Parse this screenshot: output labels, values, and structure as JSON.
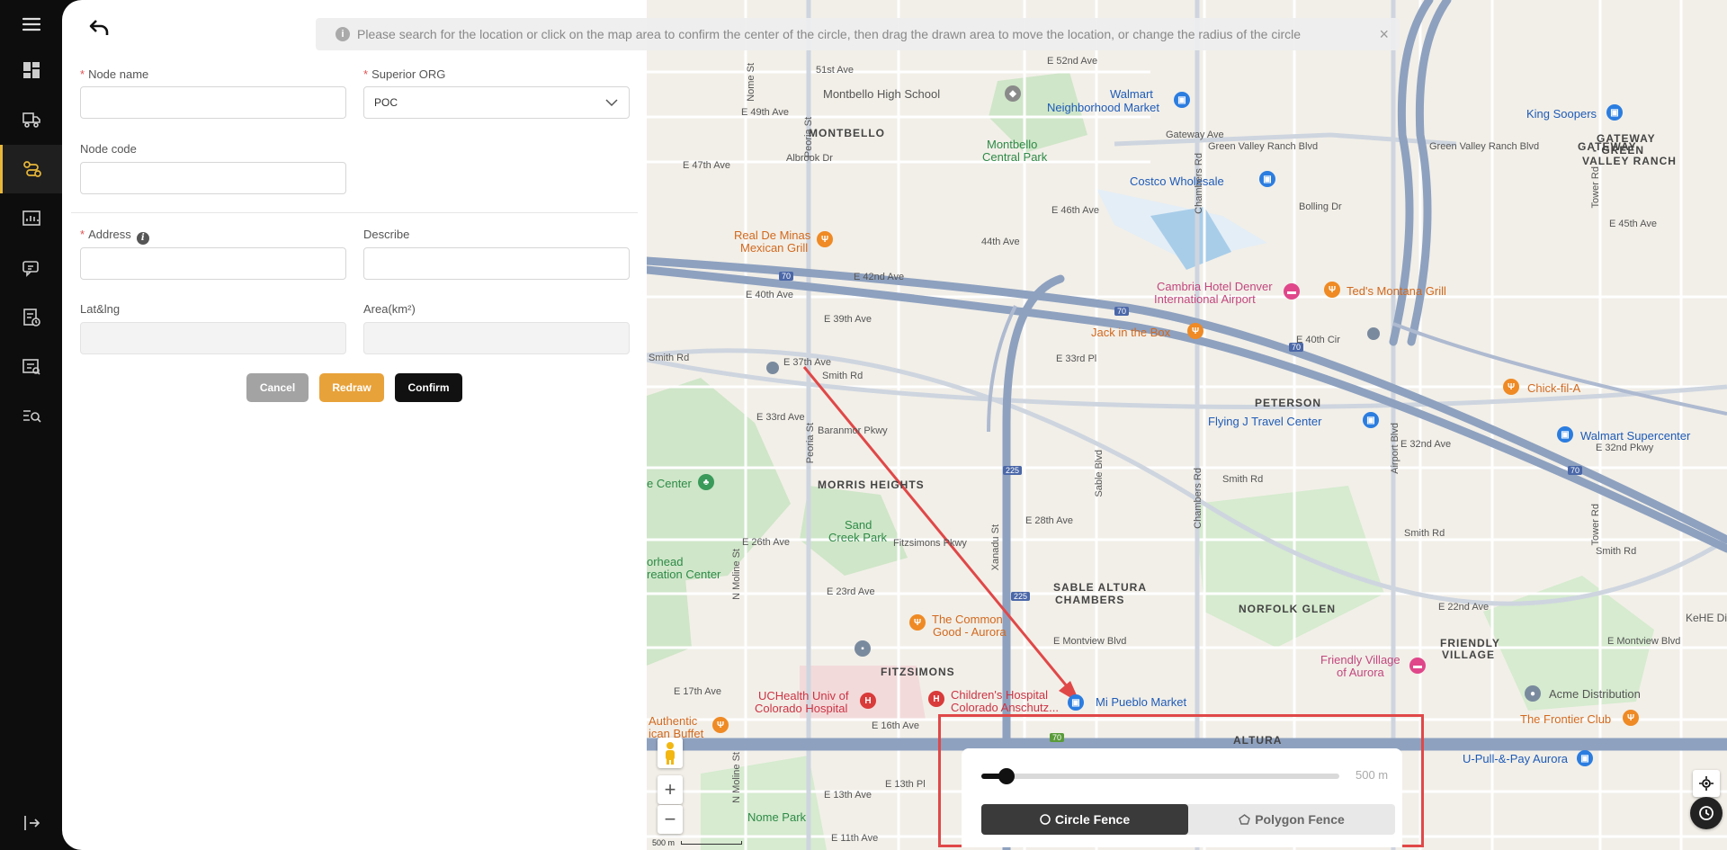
{
  "form": {
    "node_name": {
      "label": "Node name",
      "value": "",
      "required": true
    },
    "superior_org": {
      "label": "Superior ORG",
      "value": "POC",
      "required": true
    },
    "node_code": {
      "label": "Node code",
      "value": ""
    },
    "address": {
      "label": "Address",
      "value": "",
      "required": true
    },
    "describe": {
      "label": "Describe",
      "value": ""
    },
    "latlng": {
      "label": "Lat&lng",
      "value": ""
    },
    "area": {
      "label": "Area(km²)",
      "value": ""
    },
    "required_mark": "*",
    "info_glyph": "i",
    "cancel_label": "Cancel",
    "redraw_label": "Redraw",
    "confirm_label": "Confirm"
  },
  "notice": {
    "text": "Please search for the location or click on the map area to confirm the center of the circle, then drag the drawn area to move the location, or change the radius of the circle",
    "info_glyph": "i",
    "close_glyph": "×"
  },
  "fence": {
    "radius_label": "500 m",
    "radius_fraction": 0.07,
    "circle_label": "Circle Fence",
    "polygon_label": "Polygon Fence",
    "active_tab": "circle"
  },
  "map": {
    "zoom_in": "+",
    "zoom_out": "−",
    "scale_label": "500 m",
    "labels": {
      "montbello": "MONTBELLO",
      "gateway": "GATEWAY",
      "gateway_green": "GATEWAY",
      "green": "- GREEN",
      "valley_ranch": "VALLEY RANCH",
      "peterson": "PETERSON",
      "morris_heights": "MORRIS HEIGHTS",
      "sable_altura": "SABLE ALTURA",
      "chambers": "CHAMBERS",
      "norfolk_glen": "NORFOLK GLEN",
      "friendly": "FRIENDLY",
      "village": "VILLAGE",
      "fitzsimons": "FITZSIMONS",
      "altura": "ALTURA",
      "montbello_hs": "Montbello High School",
      "walmart": "Walmart",
      "nbh_market": "Neighborhood Market",
      "king_soopers": "King Soopers",
      "montbello_cp1": "Montbello",
      "montbello_cp2": "Central Park",
      "costco": "Costco Wholesale",
      "real_de_minas1": "Real De Minas",
      "real_de_minas2": "Mexican Grill",
      "cambria1": "Cambria Hotel Denver",
      "cambria2": "International Airport",
      "teds": "Ted's Montana Grill",
      "jack": "Jack in the Box",
      "flying_j": "Flying J Travel Center",
      "chick": "Chick-fil-A",
      "walmart_sc": "Walmart Supercenter",
      "sand_creek1": "Sand",
      "sand_creek2": "Creek Park",
      "common_good1": "The Common",
      "common_good2": "Good - Aurora",
      "friendly_aurora1": "Friendly Village",
      "friendly_aurora2": "of Aurora",
      "acme": "Acme Distribution",
      "frontier": "The Frontier Club",
      "uhealth1": "UCHealth Univ of",
      "uhealth2": "Colorado Hospital",
      "childrens1": "Children's Hospital",
      "childrens2": "Colorado Anschutz...",
      "mi_pueblo": "Mi Pueblo Market",
      "upull": "U-Pull-&-Pay Aurora",
      "nome_park": "Nome Park",
      "authentic1": "Authentic",
      "authentic2": "ican Buffet",
      "rec1": "orhead",
      "rec2": "reation Center",
      "center": "e Center",
      "kehe": "KeHE Di",
      "e51": "51st Ave",
      "e49": "E 49th Ave",
      "e47": "E 47th Ave",
      "e46": "E 46th Ave",
      "e45": "E 45th Ave",
      "e42": "E 42nd Ave",
      "e40": "E 40th Ave",
      "e39": "E 39th Ave",
      "e37": "E 37th Ave",
      "e33rd": "E 33rd Ave",
      "e33pl": "E 33rd Pl",
      "e32": "E 32nd Ave",
      "e32pkwy": "E 32nd Pkwy",
      "e28": "E 28th Ave",
      "e26": "E 26th Ave",
      "e23": "E 23rd Ave",
      "e22": "E 22nd Ave",
      "e17": "E 17th Ave",
      "e16": "E 16th Ave",
      "e13pl": "E 13th Pl",
      "e13": "E 13th Ave",
      "e11": "E 11th Ave",
      "montview": "E Montview Blvd",
      "green_valley": "Green Valley Ranch Blvd",
      "smith": "Smith Rd",
      "baranmor": "Baranmor Pkwy",
      "fitz_pkwy": "Fitzsimons Pkwy",
      "e40cir": "E 40th Cir",
      "e52": "E 52nd Ave",
      "gateway_ave": "Gateway Ave",
      "ave44": "44th Ave",
      "bolling": "Bolling Dr",
      "albrook": "Albrook Dr",
      "peoria": "Peoria St",
      "nome": "Nome St",
      "chambers_rd": "Chambers Rd",
      "airport_blvd": "Airport Blvd",
      "sable": "Sable Blvd",
      "xanadu": "Xanadu St",
      "moline": "N Moline St",
      "tower": "Tower Rd",
      "hwy70a": "70",
      "hwy70b": "70",
      "hwy70c": "70",
      "hwy70d": "70",
      "hwy225a": "225",
      "hwy225b": "225",
      "hwy_green": "70"
    }
  },
  "icons": {
    "accent": "#e8a23a",
    "dark": "#111111",
    "danger": "#e04848",
    "cancel": "#a3a3a3"
  }
}
